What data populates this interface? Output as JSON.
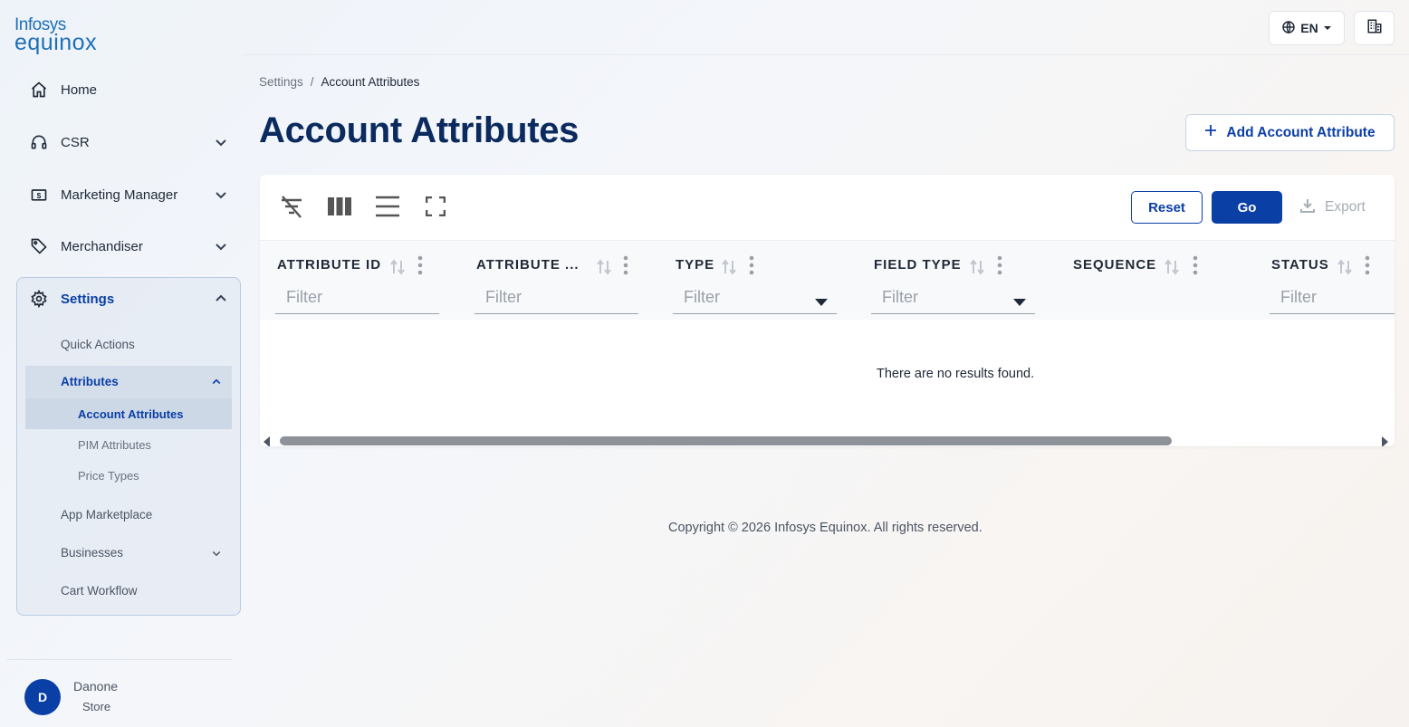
{
  "brand": {
    "line1": "Infosys",
    "line2": "equinox"
  },
  "nav": {
    "home": "Home",
    "csr": "CSR",
    "marketing": "Marketing Manager",
    "merchandiser": "Merchandiser",
    "settings": "Settings",
    "settings_items": {
      "quick_actions": "Quick Actions",
      "attributes": "Attributes",
      "account_attributes": "Account Attributes",
      "pim_attributes": "PIM Attributes",
      "price_types": "Price Types",
      "app_marketplace": "App Marketplace",
      "businesses": "Businesses",
      "cart_workflow": "Cart Workflow"
    }
  },
  "user": {
    "initial": "D",
    "name": "Danone",
    "store": "Store"
  },
  "header": {
    "language": "EN"
  },
  "breadcrumb": {
    "parent": "Settings",
    "separator": "/",
    "current": "Account Attributes"
  },
  "page": {
    "title": "Account Attributes",
    "add_button": "Add Account Attribute"
  },
  "toolbar": {
    "reset": "Reset",
    "go": "Go",
    "export": "Export"
  },
  "table": {
    "columns": [
      {
        "label": "ATTRIBUTE ID",
        "filter_placeholder": "Filter"
      },
      {
        "label": "ATTRIBUTE ...",
        "filter_placeholder": "Filter"
      },
      {
        "label": "TYPE",
        "filter_placeholder": "Filter"
      },
      {
        "label": "FIELD TYPE",
        "filter_placeholder": "Filter"
      },
      {
        "label": "SEQUENCE",
        "filter_placeholder": ""
      },
      {
        "label": "STATUS",
        "filter_placeholder": "Filter"
      }
    ],
    "empty_message": "There are no results found."
  },
  "footer": {
    "copyright": "Copyright © 2026 Infosys Equinox. All rights reserved."
  },
  "colors": {
    "primary": "#0a3fa6",
    "title": "#0b2a5e",
    "logo": "#1e6fb8"
  }
}
